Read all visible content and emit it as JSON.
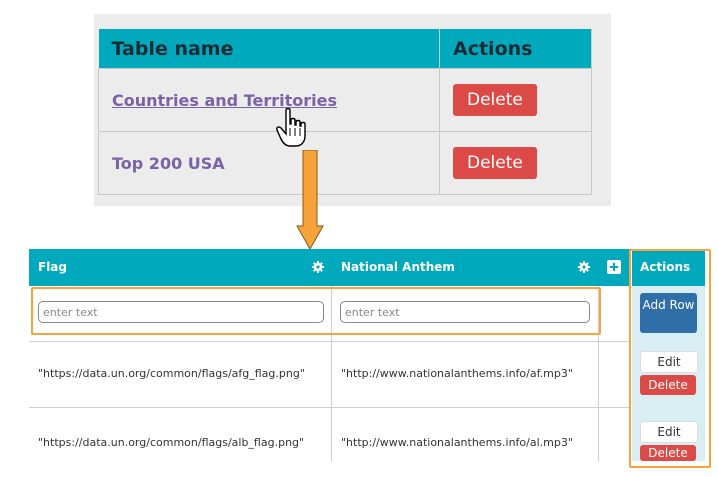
{
  "top_table": {
    "headers": {
      "table_name": "Table name",
      "actions": "Actions"
    },
    "rows": [
      {
        "name": "Countries and Territories",
        "delete": "Delete"
      },
      {
        "name": "Top 200 USA",
        "delete": "Delete"
      }
    ]
  },
  "bottom_table": {
    "headers": {
      "flag": "Flag",
      "anthem": "National Anthem",
      "actions": "Actions"
    },
    "inputs": {
      "flag_placeholder": "enter text",
      "anthem_placeholder": "enter text"
    },
    "add_row": "Add Row",
    "rows": [
      {
        "flag": "\"https://data.un.org/common/flags/afg_flag.png\"",
        "anthem": "\"http://www.nationalanthems.info/af.mp3\"",
        "edit": "Edit",
        "delete": "Delete"
      },
      {
        "flag": "\"https://data.un.org/common/flags/alb_flag.png\"",
        "anthem": "\"http://www.nationalanthems.info/al.mp3\"",
        "edit": "Edit",
        "delete": "Delete"
      }
    ]
  },
  "colors": {
    "header": "#00a9bc",
    "delete": "#db4a47",
    "highlight": "#f5a33a",
    "add": "#2f6ea8"
  }
}
